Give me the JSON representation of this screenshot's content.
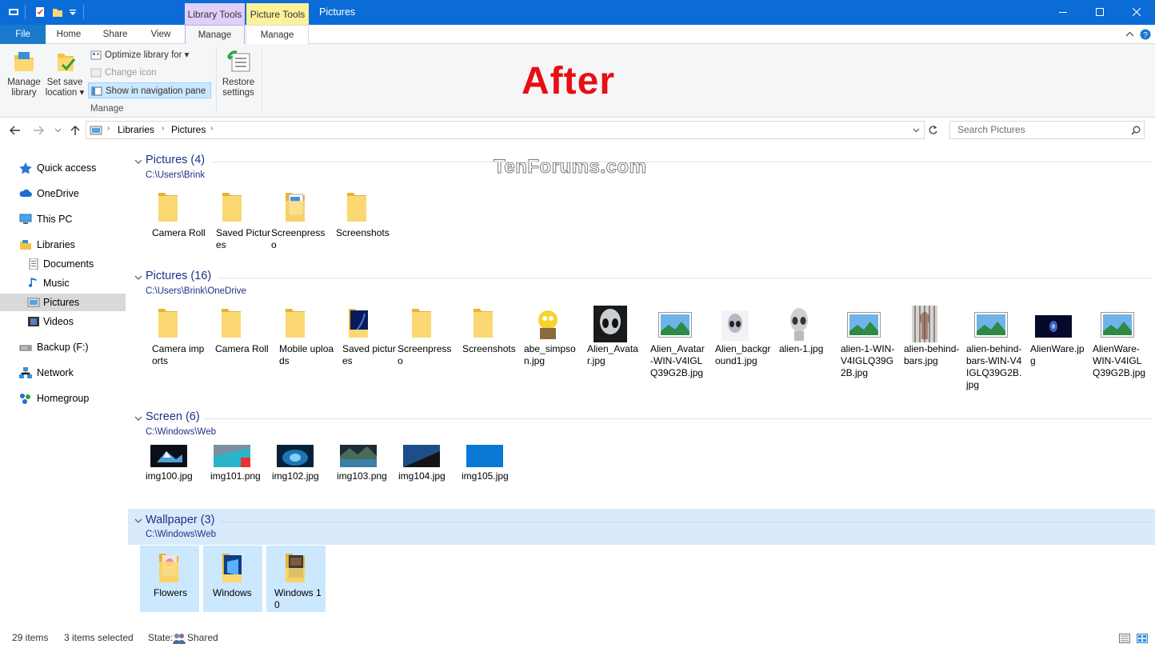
{
  "window": {
    "title": "Pictures",
    "ctx_library_tools": "Library Tools",
    "ctx_picture_tools": "Picture Tools"
  },
  "tabs": {
    "file": "File",
    "home": "Home",
    "share": "Share",
    "view": "View",
    "manage1": "Manage",
    "manage2": "Manage"
  },
  "ribbon": {
    "manage_library": [
      "Manage",
      "library"
    ],
    "set_save_location": [
      "Set save",
      "location ▾"
    ],
    "optimize": "Optimize library for ▾",
    "change_icon": "Change icon",
    "show_nav": "Show in navigation pane",
    "group_label": "Manage",
    "restore": [
      "Restore",
      "settings"
    ]
  },
  "overlay": {
    "after": "After",
    "watermark": "TenForums.com"
  },
  "address": {
    "crumbs": [
      "Libraries",
      "Pictures"
    ],
    "search_placeholder": "Search Pictures"
  },
  "nav": [
    {
      "label": "Quick access",
      "icon": "star-icon"
    },
    {
      "label": "OneDrive",
      "icon": "cloud-icon"
    },
    {
      "label": "This PC",
      "icon": "computer-icon"
    },
    {
      "label": "Libraries",
      "icon": "libraries-icon"
    },
    {
      "label": "Documents",
      "icon": "documents-icon"
    },
    {
      "label": "Music",
      "icon": "music-icon"
    },
    {
      "label": "Pictures",
      "icon": "pictures-icon"
    },
    {
      "label": "Videos",
      "icon": "videos-icon"
    },
    {
      "label": "Backup (F:)",
      "icon": "drive-icon"
    },
    {
      "label": "Network",
      "icon": "network-icon"
    },
    {
      "label": "Homegroup",
      "icon": "homegroup-icon"
    }
  ],
  "groups": [
    {
      "title": "Pictures (4)",
      "path": "C:\\Users\\Brink",
      "items": [
        "Camera Roll",
        "Saved Pictures",
        "Screenpresso",
        "Screenshots"
      ]
    },
    {
      "title": "Pictures (16)",
      "path": "C:\\Users\\Brink\\OneDrive",
      "items": [
        "Camera imports",
        "Camera Roll",
        "Mobile uploads",
        "Saved pictures",
        "Screenpresso",
        "Screenshots",
        "abe_simpson.jpg",
        "Alien_Avatar.jpg",
        "Alien_Avatar-WIN-V4IGLQ39G2B.jpg",
        "Alien_background1.jpg",
        "alien-1.jpg",
        "alien-1-WIN-V4IGLQ39G2B.jpg",
        "alien-behind-bars.jpg",
        "alien-behind-bars-WIN-V4IGLQ39G2B.jpg",
        "AlienWare.jpg",
        "AlienWare-WIN-V4IGLQ39G2B.jpg"
      ]
    },
    {
      "title": "Screen (6)",
      "path": "C:\\Windows\\Web",
      "items": [
        "img100.jpg",
        "img101.png",
        "img102.jpg",
        "img103.png",
        "img104.jpg",
        "img105.jpg"
      ]
    },
    {
      "title": "Wallpaper (3)",
      "path": "C:\\Windows\\Web",
      "items": [
        "Flowers",
        "Windows",
        "Windows 10"
      ]
    }
  ],
  "status": {
    "count": "29 items",
    "selected": "3 items selected",
    "state_label": "State:",
    "state_value": "Shared"
  },
  "colors": {
    "titlebar": "#0b6cd7",
    "selection": "#cce8ff",
    "group_header": "#1e3287",
    "after": "#e80e14"
  }
}
